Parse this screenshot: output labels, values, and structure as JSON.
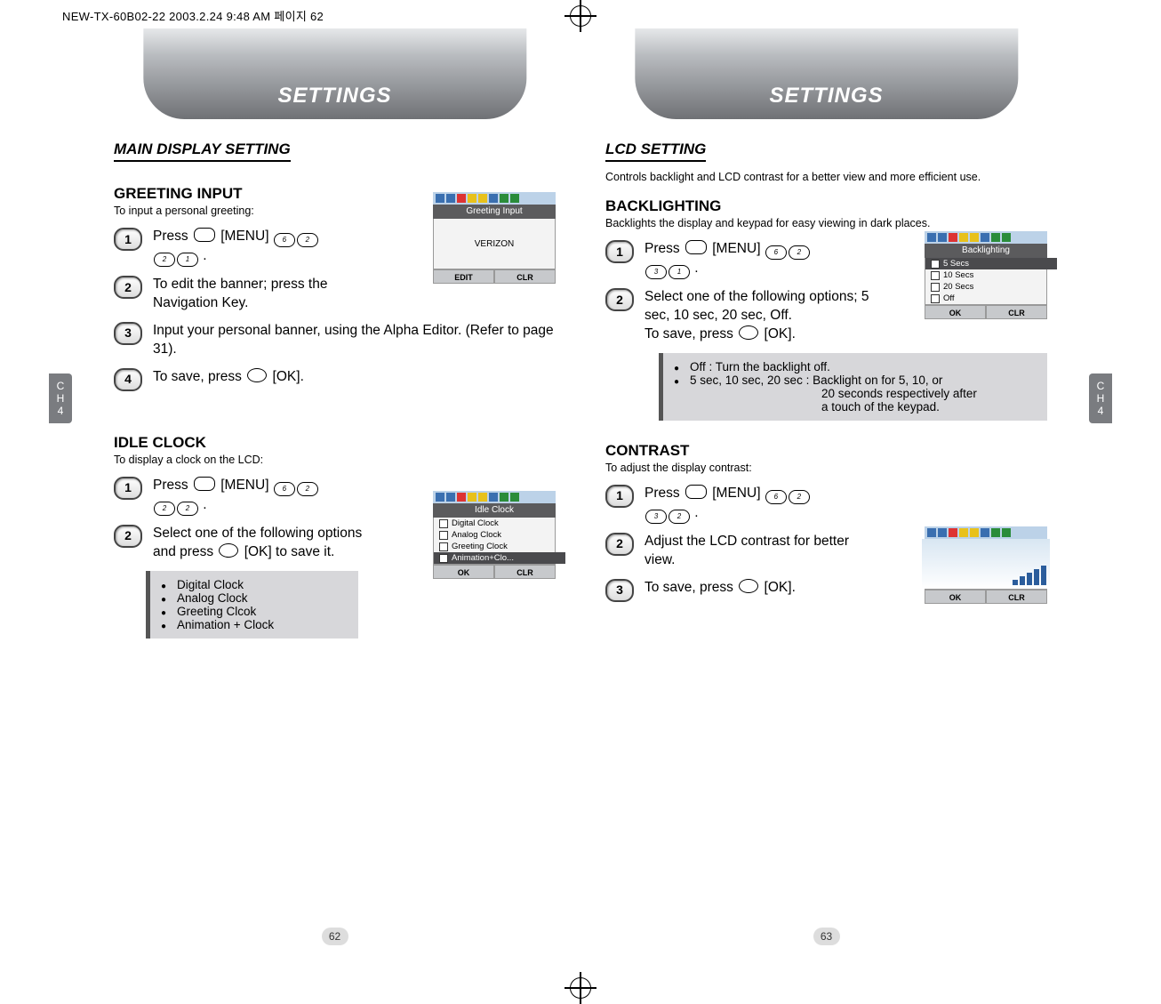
{
  "print_header": "NEW-TX-60B02-22  2003.2.24 9:48 AM  페이지 62",
  "chapter_tab": {
    "line1": "C",
    "line2": "H",
    "num": "4"
  },
  "left": {
    "tab": "SETTINGS",
    "section": "MAIN DISPLAY SETTING",
    "greeting": {
      "head": "GREETING INPUT",
      "caption": "To input a personal greeting:",
      "steps": {
        "s1": "Press        [MENU]                               .",
        "s2": "To edit the banner; press the Navigation Key.",
        "s3": "Input your personal banner, using the Alpha Editor. (Refer to page 31).",
        "s4": "To save, press        [OK]."
      },
      "phone": {
        "title": "Greeting Input",
        "value": "VERIZON",
        "soft_left": "EDIT",
        "soft_right": "CLR"
      }
    },
    "idle": {
      "head": "IDLE CLOCK",
      "caption": "To display a clock on the LCD:",
      "steps": {
        "s1": "Press        [MENU]                               .",
        "s2": "Select one of the following options and press        [OK] to save it."
      },
      "note": [
        "Digital Clock",
        "Analog Clock",
        "Greeting Clcok",
        "Animation + Clock"
      ],
      "phone": {
        "title": "Idle Clock",
        "opts": [
          "Digital Clock",
          "Analog Clock",
          "Greeting Clock",
          "Animation+Clo..."
        ],
        "selected_index": 3,
        "soft_left": "OK",
        "soft_right": "CLR"
      }
    },
    "page_num": "62"
  },
  "right": {
    "tab": "SETTINGS",
    "section": "LCD SETTING",
    "section_caption": "Controls backlight and LCD contrast for a better view and more efficient use.",
    "backlight": {
      "head": "BACKLIGHTING",
      "caption": "Backlights the display and keypad for easy viewing in dark places.",
      "steps": {
        "s1": "Press        [MENU]                              .",
        "s2a": "Select one of the following options;  5 sec, 10 sec, 20 sec, Off.",
        "s2b": "To save, press        [OK]."
      },
      "note": {
        "l1": "Off : Turn the backlight off.",
        "l2a": "5 sec, 10 sec, 20 sec  : Backlight on for 5, 10, or",
        "l2b": "20 seconds respectively after",
        "l2c": "a touch of the keypad."
      },
      "phone": {
        "title": "Backlighting",
        "opts": [
          "5 Secs",
          "10 Secs",
          "20 Secs",
          "Off"
        ],
        "selected_index": 0,
        "soft_left": "OK",
        "soft_right": "CLR"
      }
    },
    "contrast": {
      "head": "CONTRAST",
      "caption": "To adjust the display contrast:",
      "steps": {
        "s1": "Press        [MENU]                              .",
        "s2": "Adjust the LCD contrast for better view.",
        "s3": "To save, press        [OK]."
      },
      "phone": {
        "soft_left": "OK",
        "soft_right": "CLR"
      }
    },
    "page_num": "63"
  }
}
